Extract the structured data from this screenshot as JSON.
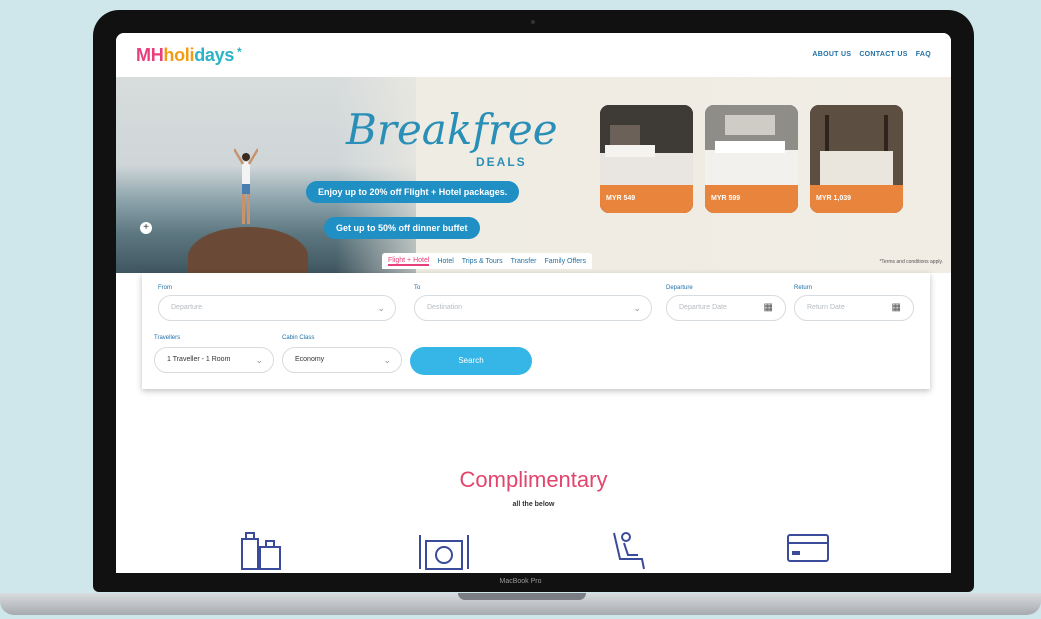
{
  "device": {
    "label": "MacBook Pro"
  },
  "logo": {
    "mh": "MH",
    "hol": "holi",
    "days": "days",
    "star": "*"
  },
  "topnav": [
    "ABOUT US",
    "CONTACT US",
    "FAQ"
  ],
  "hero": {
    "title": "Breakfree",
    "subtitle": "DEALS",
    "pill1": "Enjoy up to 20% off Flight + Hotel packages.",
    "pill2": "Get up to 50% off dinner buffet",
    "cards": [
      {
        "caption": "",
        "price": "MYR 549"
      },
      {
        "caption": "",
        "price": "MYR 599"
      },
      {
        "caption": "",
        "price": "MYR 1,039"
      }
    ],
    "terms": "*Terms and conditions apply."
  },
  "tabs": [
    "Flight + Hotel",
    "Hotel",
    "Trips & Tours",
    "Transfer",
    "Family Offers"
  ],
  "form": {
    "from_label": "From",
    "from_placeholder": "Departure",
    "to_label": "To",
    "to_placeholder": "Destination",
    "depart_label": "Departure",
    "depart_placeholder": "Departure Date",
    "return_label": "Return",
    "return_placeholder": "Return Date",
    "travellers_label": "Travellers",
    "travellers_value": "1 Traveller - 1 Room",
    "cabin_label": "Cabin Class",
    "cabin_value": "Economy",
    "search_label": "Search"
  },
  "complimentary": {
    "title": "Complimentary",
    "subtitle": "all the below"
  },
  "colors": {
    "brand_pink": "#e83e7b",
    "brand_blue": "#1f8fc4",
    "accent_orange": "#e8843c"
  }
}
